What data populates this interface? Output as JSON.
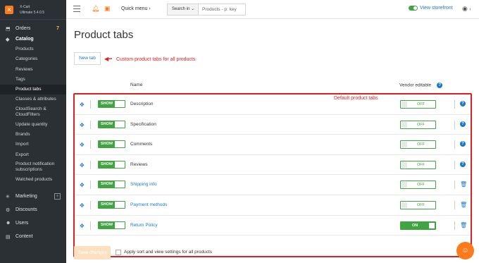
{
  "brand": {
    "name": "X-Cart",
    "version": "Ultimate 5.4.0.5"
  },
  "sidebar": {
    "orders": {
      "label": "Orders",
      "badge": "7"
    },
    "catalog": {
      "label": "Catalog"
    },
    "catalog_items": [
      "Products",
      "Categories",
      "Reviews",
      "Tags",
      "Product tabs",
      "Classes & attributes",
      "CloudSearch & CloudFilters",
      "Update quantity",
      "Brands",
      "Import",
      "Export",
      "Product notification subscriptions",
      "Watched products"
    ],
    "marketing": {
      "label": "Marketing"
    },
    "discounts": {
      "label": "Discounts"
    },
    "users": {
      "label": "Users"
    },
    "content": {
      "label": "Content"
    }
  },
  "topbar": {
    "quick_menu": "Quick menu ›",
    "search_in": "Search in ⌄",
    "search_placeholder": "Products - p: key",
    "storefront": "View storefront",
    "user_chevron": "›"
  },
  "page": {
    "title": "Product tabs",
    "new_tab": "New tab",
    "annotation_custom": "Custom product tabs for all products",
    "annotation_default": "Default product tabs",
    "col_name": "Name",
    "col_vendor": "Vendor editable",
    "show_label": "SHOW"
  },
  "rows": [
    {
      "name": "Description",
      "vendor": "OFF",
      "link": false,
      "action": "help"
    },
    {
      "name": "Specification",
      "vendor": "OFF",
      "link": false,
      "action": "help"
    },
    {
      "name": "Comments",
      "vendor": "OFF",
      "link": false,
      "action": "help"
    },
    {
      "name": "Reviews",
      "vendor": "OFF",
      "link": false,
      "action": "help"
    },
    {
      "name": "Shipping info",
      "vendor": "OFF",
      "link": true,
      "action": "trash"
    },
    {
      "name": "Payment methods",
      "vendor": "OFF",
      "link": true,
      "action": "trash"
    },
    {
      "name": "Return Policy",
      "vendor": "ON",
      "link": true,
      "action": "trash"
    }
  ],
  "footer": {
    "save": "Save changes",
    "apply_label": "Apply sort and view settings for all products"
  },
  "colors": {
    "accent": "#1b78c7",
    "green": "#41a342",
    "orange": "#ff7a1a",
    "annotation": "#e02020"
  }
}
